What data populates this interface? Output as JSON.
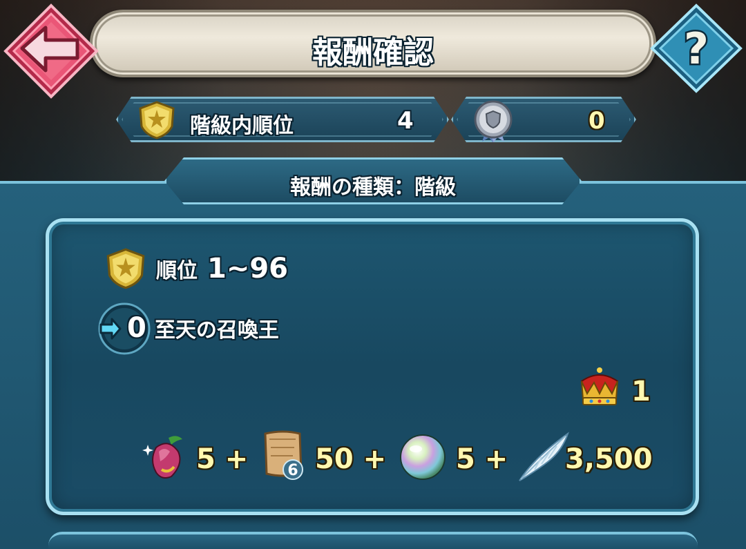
{
  "header": {
    "title": "報酬確認",
    "back_icon": "back-arrow-icon",
    "help_label": "?"
  },
  "stats": {
    "rank_label": "階級内順位",
    "rank_value": "4",
    "medal_value": "0"
  },
  "section": {
    "title": "報酬の種類：階級"
  },
  "reward": {
    "rank_label": "順位",
    "rank_range": "1~96",
    "title_prefix": "0",
    "title_name": "至天の召喚王",
    "crown_count": "1",
    "items": [
      {
        "icon": "fruit-icon",
        "value": "5 +"
      },
      {
        "icon": "scroll-icon",
        "badge": "6",
        "value": "50 +"
      },
      {
        "icon": "orb-icon",
        "value": "5 +"
      },
      {
        "icon": "feather-icon",
        "value": "3,500"
      }
    ]
  },
  "colors": {
    "back_button": "#e8506f",
    "help_button": "#2f8fb5",
    "panel": "#1d5670",
    "panel_border": "#a9e1f2",
    "gold_text": "#fff8b0"
  }
}
